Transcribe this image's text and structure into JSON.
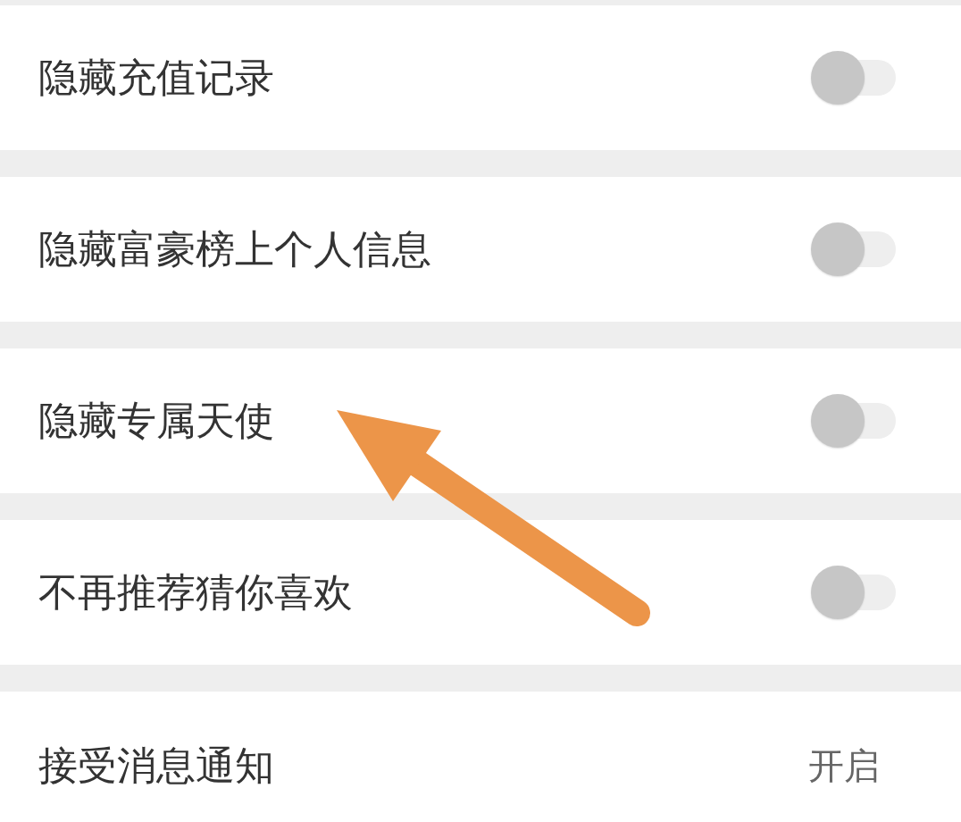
{
  "rows": [
    {
      "kind": "toggle",
      "label": "隐藏充值记录",
      "on": false
    },
    {
      "kind": "toggle",
      "label": "隐藏富豪榜上个人信息",
      "on": false
    },
    {
      "kind": "toggle",
      "label": "隐藏专属天使",
      "on": false
    },
    {
      "kind": "toggle",
      "label": "不再推荐猜你喜欢",
      "on": false
    },
    {
      "kind": "value",
      "label": "接受消息通知",
      "value": "开启"
    }
  ],
  "annotation": {
    "kind": "arrow"
  }
}
